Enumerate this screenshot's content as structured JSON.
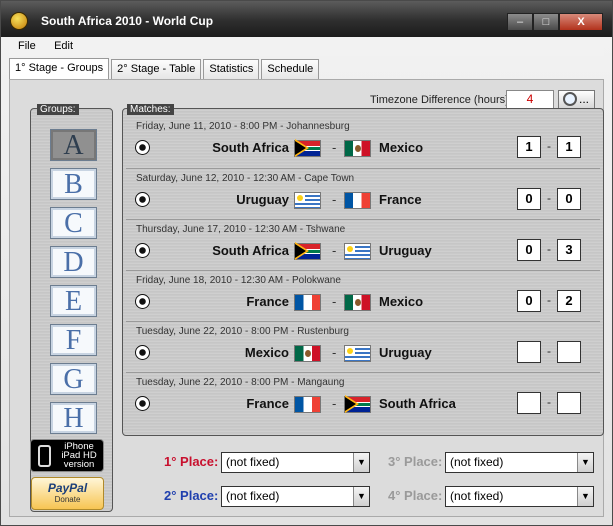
{
  "window": {
    "title": "South Africa 2010 - World Cup",
    "controls": {
      "minimize": "–",
      "maximize": "□",
      "close": "X"
    }
  },
  "menu": [
    "File",
    "Edit"
  ],
  "tabs": [
    "1° Stage - Groups",
    "2° Stage - Table",
    "Statistics",
    "Schedule"
  ],
  "groups": {
    "label": "Groups:",
    "items": [
      "A",
      "B",
      "C",
      "D",
      "E",
      "F",
      "G",
      "H"
    ],
    "selected": "A"
  },
  "promo": {
    "iphone_lines": [
      "iPhone",
      "iPad HD",
      "version"
    ],
    "paypal_logo": "PayPal",
    "paypal_sub": "Donate"
  },
  "matches_label": "Matches:",
  "timezone": {
    "label": "Timezone Difference (hours):",
    "value": "4",
    "button": "..."
  },
  "matches": [
    {
      "date": "Friday, June 11, 2010 - 8:00 PM - Johannesburg",
      "home": "South Africa",
      "home_flag": "za",
      "away": "Mexico",
      "away_flag": "mx",
      "home_score": "1",
      "away_score": "1"
    },
    {
      "date": "Saturday, June 12, 2010 - 12:30 AM - Cape Town",
      "home": "Uruguay",
      "home_flag": "uy",
      "away": "France",
      "away_flag": "fr",
      "home_score": "0",
      "away_score": "0"
    },
    {
      "date": "Thursday, June 17, 2010 - 12:30 AM - Tshwane",
      "home": "South Africa",
      "home_flag": "za",
      "away": "Uruguay",
      "away_flag": "uy",
      "home_score": "0",
      "away_score": "3"
    },
    {
      "date": "Friday, June 18, 2010 - 12:30 AM - Polokwane",
      "home": "France",
      "home_flag": "fr",
      "away": "Mexico",
      "away_flag": "mx",
      "home_score": "0",
      "away_score": "2"
    },
    {
      "date": "Tuesday, June 22, 2010 - 8:00 PM - Rustenburg",
      "home": "Mexico",
      "home_flag": "mx",
      "away": "Uruguay",
      "away_flag": "uy",
      "home_score": "",
      "away_score": ""
    },
    {
      "date": "Tuesday, June 22, 2010 - 8:00 PM - Mangaung",
      "home": "France",
      "home_flag": "fr",
      "away": "South Africa",
      "away_flag": "za",
      "home_score": "",
      "away_score": ""
    }
  ],
  "places": [
    {
      "label": "1° Place:",
      "value": "(not fixed)",
      "color": "#c8102e"
    },
    {
      "label": "2° Place:",
      "value": "(not fixed)",
      "color": "#1f3fae"
    },
    {
      "label": "3° Place:",
      "value": "(not fixed)",
      "color": "#9a9a9a"
    },
    {
      "label": "4° Place:",
      "value": "(not fixed)",
      "color": "#9a9a9a"
    }
  ],
  "match_separator": "-",
  "dropdown_arrow": "▼"
}
